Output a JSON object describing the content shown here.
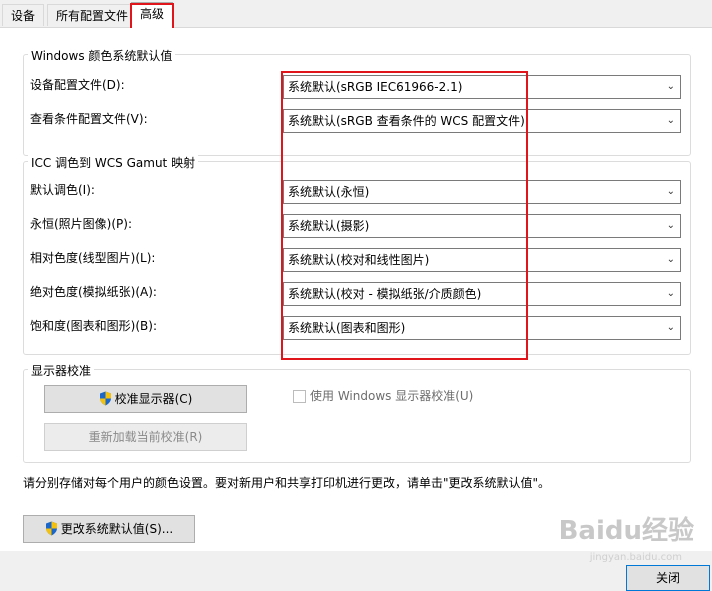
{
  "tabs": [
    {
      "label": "设备"
    },
    {
      "label": "所有配置文件"
    },
    {
      "label": "高级"
    }
  ],
  "windows_defaults": {
    "title": "Windows 颜色系统默认值",
    "device_profile_label": "设备配置文件(D):",
    "device_profile_value": "系统默认(sRGB IEC61966-2.1)",
    "viewing_profile_label": "查看条件配置文件(V):",
    "viewing_profile_value": "系统默认(sRGB 查看条件的 WCS 配置文件)"
  },
  "gamut_mapping": {
    "title": "ICC 调色到 WCS Gamut 映射",
    "rows": [
      {
        "label": "默认调色(I):",
        "value": "系统默认(永恒)"
      },
      {
        "label": "永恒(照片图像)(P):",
        "value": "系统默认(摄影)"
      },
      {
        "label": "相对色度(线型图片)(L):",
        "value": "系统默认(校对和线性图片)"
      },
      {
        "label": "绝对色度(模拟纸张)(A):",
        "value": "系统默认(校对 - 模拟纸张/介质颜色)"
      },
      {
        "label": "饱和度(图表和图形)(B):",
        "value": "系统默认(图表和图形)"
      }
    ]
  },
  "calibration": {
    "title": "显示器校准",
    "calibrate_button": "校准显示器(C)",
    "reload_button": "重新加载当前校准(R)",
    "use_windows_checkbox": "使用 Windows 显示器校准(U)",
    "use_windows_checked": false
  },
  "note": "请分别存储对每个用户的颜色设置。要对新用户和共享打印机进行更改，请单击\"更改系统默认值\"。",
  "change_defaults_button": "更改系统默认值(S)...",
  "close_button": "关闭",
  "watermark": "Baidu经验",
  "watermark_sub": "jingyan.baidu.com",
  "colors": {
    "highlight_red": "#e0151b",
    "shield_blue": "#1a66c9",
    "shield_yellow": "#f4c20d"
  }
}
